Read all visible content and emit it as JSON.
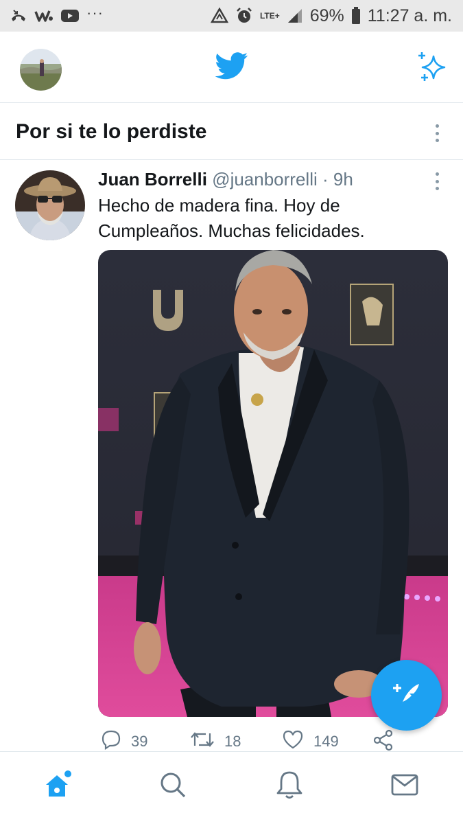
{
  "status_bar": {
    "left_icons": [
      "missed-call-icon",
      "w-app-icon",
      "youtube-icon"
    ],
    "more": "···",
    "network": "LTE+",
    "battery": "69%",
    "time": "11:27 a. m."
  },
  "header": {
    "logo": "twitter-bird-icon",
    "sparkle": "sparkle-icon"
  },
  "section": {
    "title": "Por si te lo perdiste"
  },
  "tweet": {
    "author_name": "Juan Borrelli",
    "author_handle": "@juanborrelli",
    "separator": "·",
    "time": "9h",
    "text": "Hecho de madera fina. Hoy de Cumpleaños. Muchas felicidades.",
    "actions": {
      "reply_count": "39",
      "retweet_count": "18",
      "like_count": "149"
    }
  },
  "colors": {
    "brand": "#1da1f2",
    "secondary_text": "#657786",
    "divider": "#e1e8ed",
    "status_bar_bg": "#e9e9e9"
  },
  "bottom_nav": [
    "home-icon",
    "search-icon",
    "notifications-icon",
    "messages-icon"
  ]
}
